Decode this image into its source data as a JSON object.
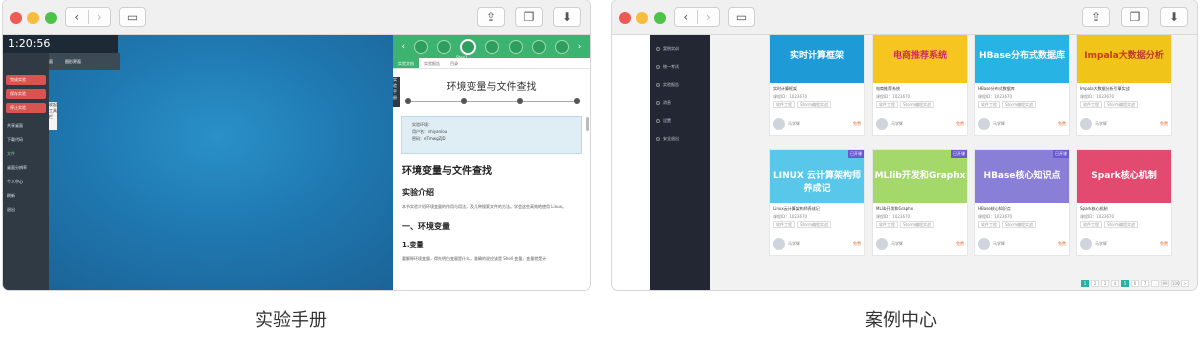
{
  "left_window": {
    "clock": "1:20:56",
    "top_strip": [
      "活动终端",
      "命令界面",
      "图形界面"
    ],
    "red_buttons": [
      "完成实验",
      "保存实验",
      "停止实验"
    ],
    "menu_items": [
      "共享桌面",
      "下载代码",
      "文件",
      "桌面分辨率",
      "个人中心",
      "刷新",
      "退出"
    ],
    "collapse_label": "收起工具栏",
    "side_label": "实验手册",
    "toolbar_caption": "Step1",
    "tabs": [
      "实验文档",
      "实验报告",
      "目录"
    ],
    "doc_title": "环境变量与文件查找",
    "env_box": {
      "heading": "实验环境：",
      "user": "用户名：shiyanlou",
      "password": "密码：eTmwgZJD"
    },
    "h1": "环境变量与文件查找",
    "h2_intro": "实验介绍",
    "intro_text": "本节实验介绍环境变量的作用与用法，及几种搜索文件的方法。学会这些高效地使用 Linux。",
    "h2_section": "一、环境变量",
    "h3_var": "1.变量",
    "var_text": "要解释环境变量，得先明白变量是什么，准确的说应该是 Shell 变量，变量就是计"
  },
  "right_window": {
    "sidebar": [
      "案例实训",
      "统一考试",
      "实验报告",
      "消息",
      "设置",
      "安全退出"
    ],
    "cards": [
      {
        "thumb_text": "实时计算框架",
        "title": "实时计算框架",
        "id": "课程ID：1023670",
        "tags": [
          "软件工程",
          "Storm编程实战"
        ],
        "author": "马学辉",
        "price": "免费",
        "bg": "#1e9bd7",
        "fg": "#ffffff"
      },
      {
        "thumb_text": "电商推荐系统",
        "title": "电商推荐系统",
        "id": "课程ID：1023670",
        "tags": [
          "软件工程",
          "Storm编程实战"
        ],
        "author": "马学辉",
        "price": "免费",
        "bg": "#f7c520",
        "fg": "#d6246e"
      },
      {
        "thumb_text": "HBase分布式数据库",
        "title": "HBase分布式数据库",
        "id": "课程ID：1023670",
        "tags": [
          "软件工程",
          "Storm编程实战"
        ],
        "author": "马学辉",
        "price": "免费",
        "bg": "#27b3e3",
        "fg": "#ffffff"
      },
      {
        "thumb_text": "Impala大数据分析",
        "title": "Impala大数据分析引擎实战",
        "id": "课程ID：1023670",
        "tags": [
          "软件工程",
          "Storm编程实战"
        ],
        "author": "马学辉",
        "price": "免费",
        "bg": "#f0c419",
        "fg": "#c0392b"
      },
      {
        "thumb_text": "LINUX 云计算架构师养成记",
        "title": "Linux云计算架构师养成记",
        "id": "课程ID：1023670",
        "tags": [
          "软件工程",
          "Storm编程实战"
        ],
        "author": "马学辉",
        "price": "免费",
        "bg": "#58c7ea",
        "fg": "#ffffff"
      },
      {
        "thumb_text": "MLlib开发和Graphx",
        "title": "MLlib开发和Graphx",
        "id": "课程ID：1023670",
        "tags": [
          "软件工程",
          "Storm编程实战"
        ],
        "author": "马学辉",
        "price": "免费",
        "bg": "#a5d86a",
        "fg": "#ffffff"
      },
      {
        "thumb_text": "HBase核心知识点",
        "title": "HBase核心知识点",
        "id": "课程ID：1023670",
        "tags": [
          "软件工程",
          "Storm编程实战"
        ],
        "author": "马学辉",
        "price": "免费",
        "bg": "#8a7fd6",
        "fg": "#ffffff"
      },
      {
        "thumb_text": "Spark核心机制",
        "title": "Spark核心机制",
        "id": "课程ID：1023670",
        "tags": [
          "软件工程",
          "Storm编程实战"
        ],
        "author": "马学辉",
        "price": "免费",
        "bg": "#e24b6f",
        "fg": "#ffffff"
      }
    ],
    "ribbons": [
      "已开课",
      "已开课",
      "已开课"
    ],
    "pager": [
      "1",
      "2",
      "3",
      "4",
      "5",
      "6",
      "7",
      "...",
      "99",
      "100",
      ">"
    ],
    "pager_active": "5"
  },
  "captions": {
    "left": "实验手册",
    "right": "案例中心"
  },
  "icons": {
    "share": "share-icon",
    "copy": "copy-icon",
    "download": "download-icon",
    "sidebar": "sidebar-icon"
  }
}
